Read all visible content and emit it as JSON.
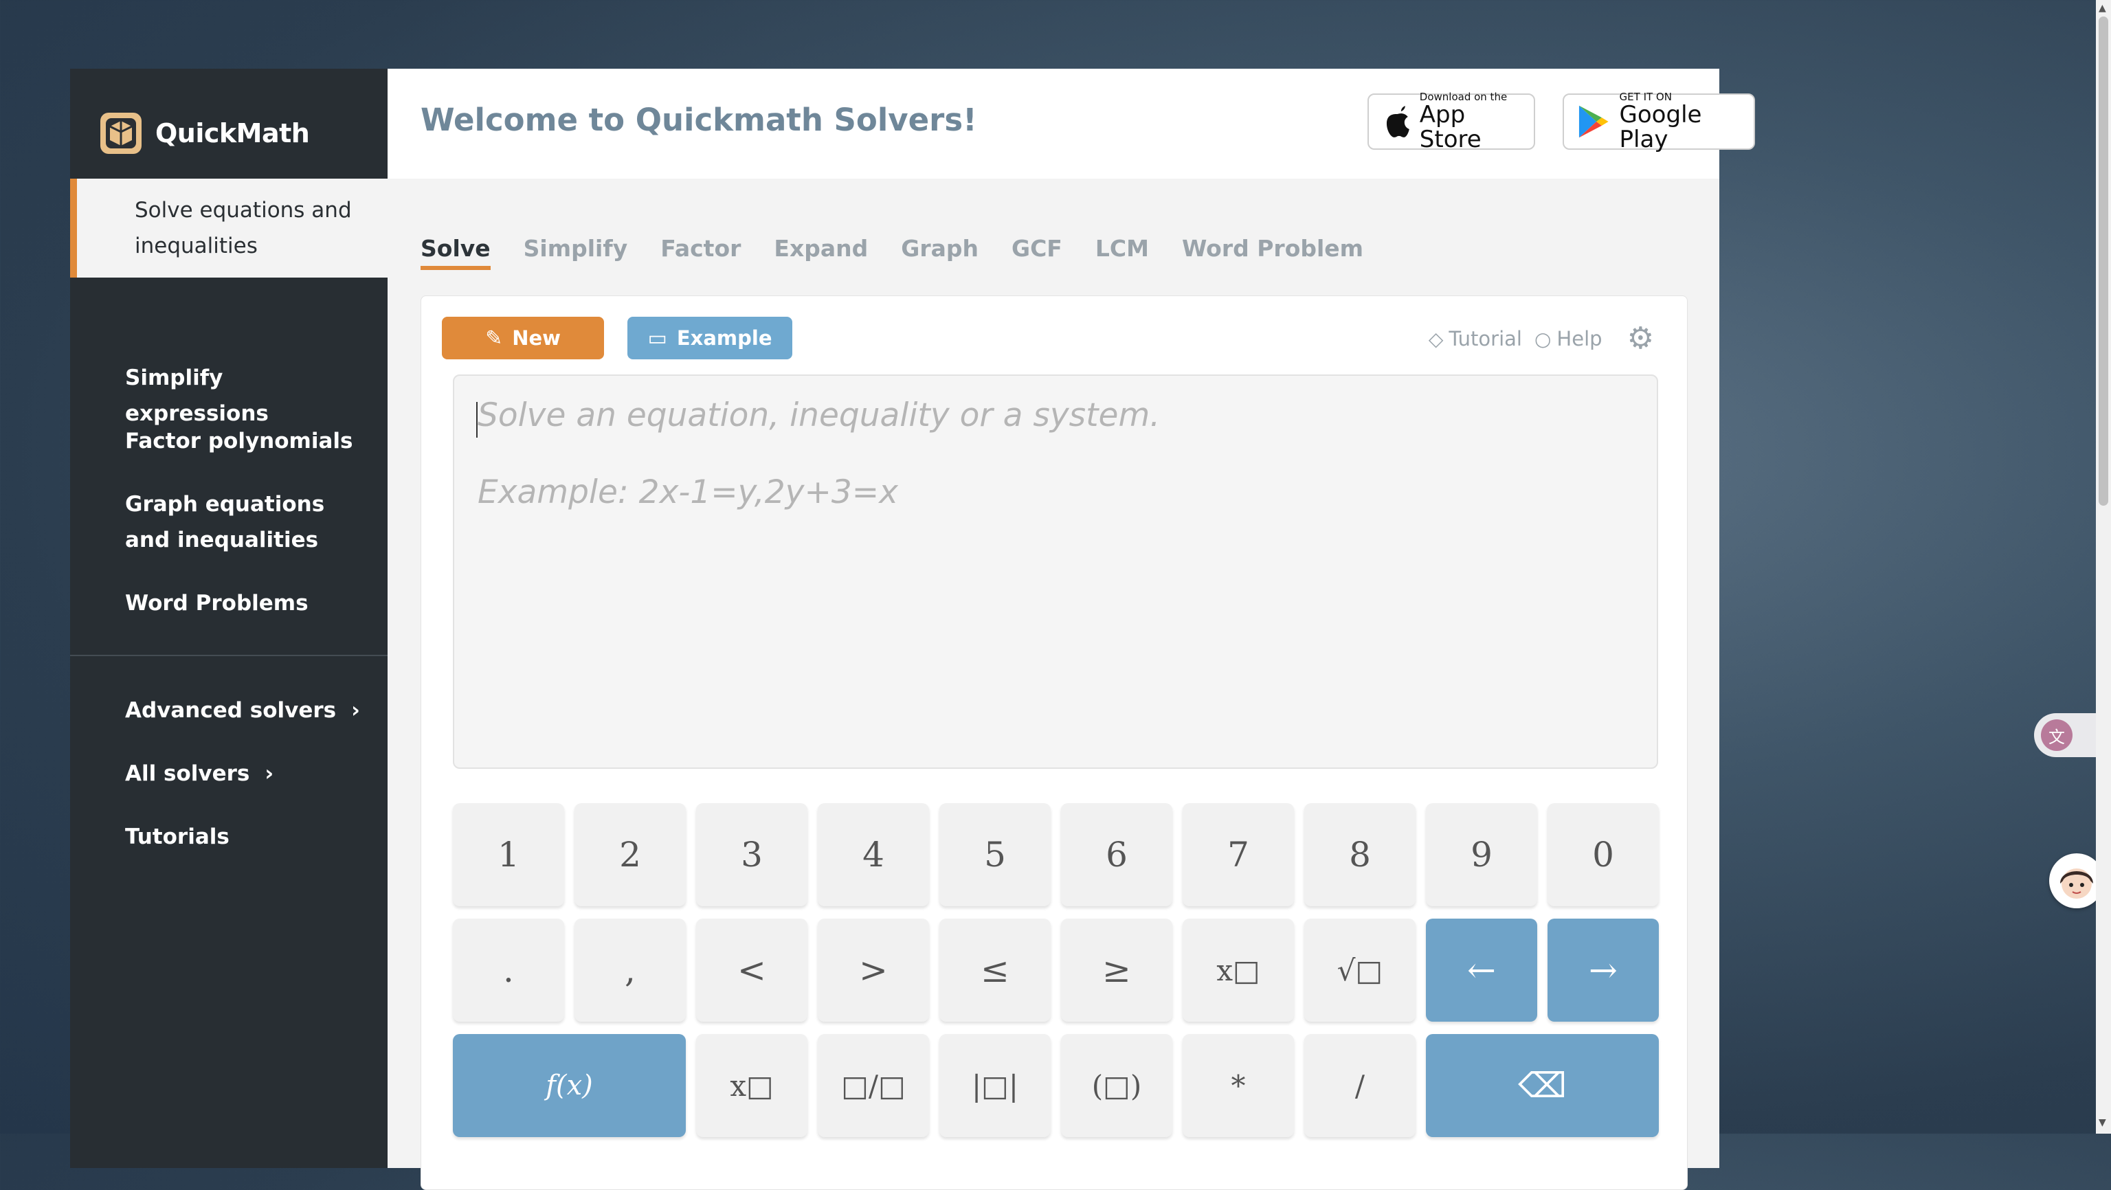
{
  "brand": {
    "name": "QuickMath"
  },
  "sidebar": {
    "active_item": "Solve equations and inequalities",
    "items": [
      "Simplify expressions",
      "Factor polynomials",
      "Graph equations and inequalities",
      "Word Problems"
    ],
    "secondary": [
      "Advanced solvers",
      "All solvers",
      "Tutorials"
    ]
  },
  "header": {
    "title": "Welcome to Quickmath Solvers!",
    "app_store": {
      "small": "Download on the",
      "big": "App Store"
    },
    "google_play": {
      "small": "GET IT ON",
      "big": "Google Play"
    }
  },
  "tabs": [
    "Solve",
    "Simplify",
    "Factor",
    "Expand",
    "Graph",
    "GCF",
    "LCM",
    "Word Problem"
  ],
  "toolbar": {
    "new_label": "New",
    "example_label": "Example",
    "tutorial_label": "Tutorial",
    "help_label": "Help"
  },
  "editor": {
    "placeholder_line1": "Solve an equation, inequality or a system.",
    "placeholder_line2": "Example: 2x-1=y,2y+3=x"
  },
  "keypad": {
    "row1": [
      "1",
      "2",
      "3",
      "4",
      "5",
      "6",
      "7",
      "8",
      "9",
      "0"
    ],
    "row2": [
      ".",
      ",",
      "<",
      ">",
      "≤",
      "≥",
      "x□",
      "√□",
      "←",
      "→"
    ],
    "row3": [
      "f(x)",
      "x□",
      "□/□",
      "|□|",
      "(□)",
      "*",
      "/",
      "⌫"
    ]
  },
  "colors": {
    "accent": "#e08a3a",
    "blue": "#6fa3c8",
    "sidebar": "#282e33",
    "title": "#6f8799"
  }
}
